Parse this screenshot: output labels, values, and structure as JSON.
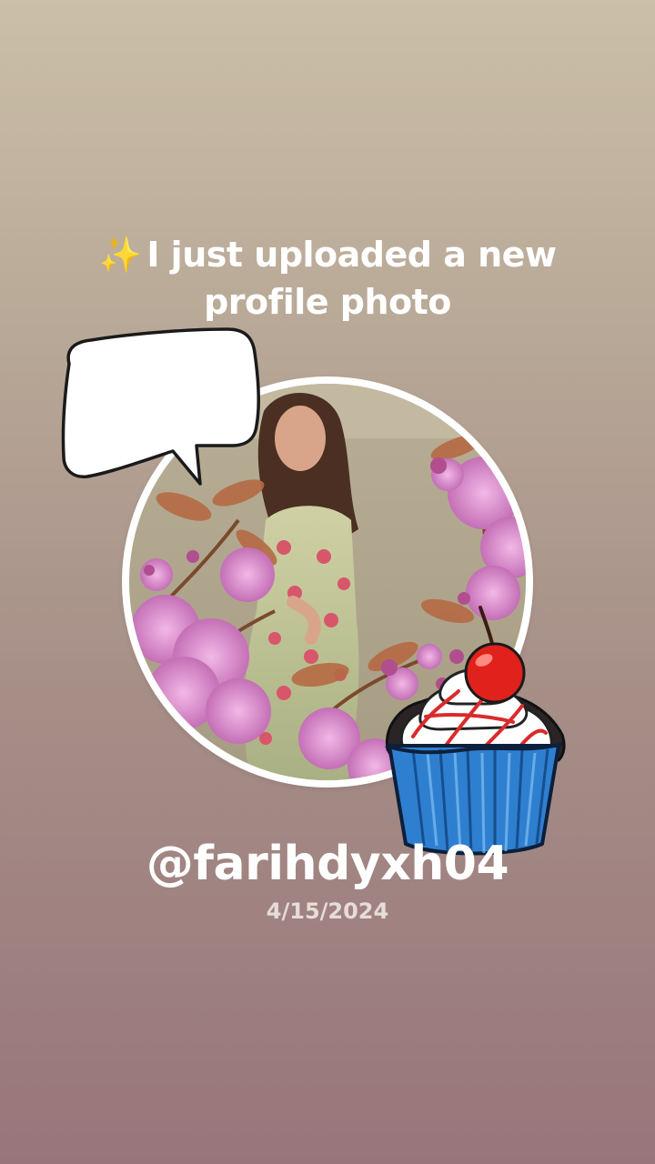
{
  "headline": {
    "sparkle_icon": "✨",
    "line1": "I just uploaded a new",
    "line2": "profile photo"
  },
  "profile": {
    "username": "@farihdyxh04",
    "date": "4/15/2024"
  },
  "stickers": {
    "speech_bubble": "speech-bubble-icon",
    "cupcake": "cherry-cupcake-icon"
  },
  "colors": {
    "text": "#ffffff",
    "date_text": "#e6dcd8",
    "gradient_top": "#cbbfa8",
    "gradient_bottom": "#98757a",
    "frame": "#ffffff"
  }
}
